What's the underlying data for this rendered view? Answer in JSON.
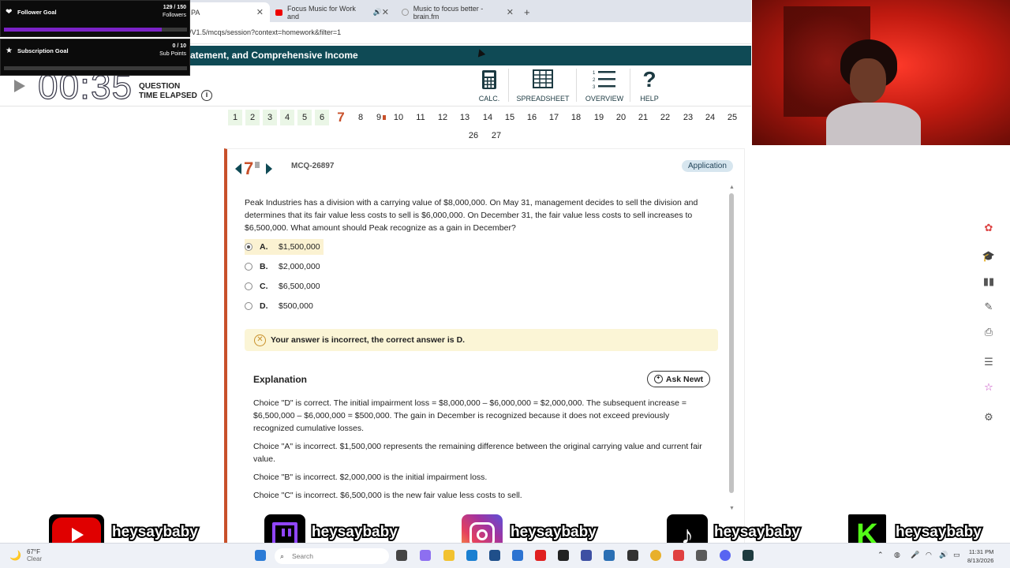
{
  "browser": {
    "tabs": [
      {
        "label": "PA",
        "active": true
      },
      {
        "label": "Focus Music for Work and",
        "active": false
      },
      {
        "label": "Music to focus better - brain.fm",
        "active": false
      }
    ],
    "new_tab": "+",
    "url": "/V1.5/mcqs/session?context=homework&filter=1"
  },
  "app": {
    "header_title": "atement, and Comprehensive Income",
    "timer": "00:35",
    "timer_label_1": "QUESTION",
    "timer_label_2": "TIME ELAPSED",
    "tools": [
      "CALC.",
      "SPREADSHEET",
      "OVERVIEW",
      "HELP"
    ]
  },
  "qnav": {
    "row1": [
      "1",
      "2",
      "3",
      "4",
      "5",
      "6",
      "7",
      "8",
      "9",
      "10",
      "11",
      "12",
      "13",
      "14",
      "15",
      "16",
      "17",
      "18",
      "19",
      "20",
      "21",
      "22",
      "23",
      "24",
      "25"
    ],
    "row2": [
      "26",
      "27"
    ],
    "current": "7"
  },
  "question": {
    "number": "7",
    "id": "MCQ-26897",
    "badge": "Application",
    "stem": "Peak Industries has a division with a carrying value of $8,000,000. On May 31, management decides to sell the division and determines that its fair value less costs to sell is $6,000,000. On December 31, the fair value less costs to sell increases to $6,500,000. What amount should Peak recognize as a gain in December?",
    "choices": [
      {
        "letter": "A.",
        "text": "$1,500,000",
        "selected": true
      },
      {
        "letter": "B.",
        "text": "$2,000,000",
        "selected": false
      },
      {
        "letter": "C.",
        "text": "$6,500,000",
        "selected": false
      },
      {
        "letter": "D.",
        "text": "$500,000",
        "selected": false
      }
    ],
    "feedback": "Your answer is incorrect, the correct answer is D."
  },
  "explanation": {
    "title": "Explanation",
    "ask_button": "Ask Newt",
    "paragraphs": [
      "Choice \"D\" is correct. The initial impairment loss = $8,000,000 – $6,000,000 = $2,000,000. The subsequent increase = $6,500,000 – $6,000,000 = $500,000. The gain in December is recognized because it does not exceed previously recognized cumulative losses.",
      "Choice \"A\" is incorrect. $1,500,000 represents the remaining difference between the original carrying value and current fair value.",
      "Choice \"B\" is incorrect. $2,000,000 is the initial impairment loss.",
      "Choice \"C\" is incorrect. $6,500,000 is the new fair value less costs to sell."
    ]
  },
  "overlay": {
    "follower_goal": {
      "name": "Follower Goal",
      "value": "129 / 150",
      "sub": "Followers",
      "progress": 0.86
    },
    "sub_goal": {
      "name": "Subscription Goal",
      "value": "0 / 10",
      "sub": "Sub Points",
      "progress": 0.0
    },
    "socials": [
      {
        "platform": "youtube",
        "handle": "heysaybaby",
        "color": "#e00000"
      },
      {
        "platform": "twitch",
        "handle": "heysaybaby",
        "color": "#7a3fd0"
      },
      {
        "platform": "instagram",
        "handle": "heysaybaby",
        "color": "#d6249f"
      },
      {
        "platform": "tiktok",
        "handle": "heysaybaby",
        "color": "#000000"
      },
      {
        "platform": "kick",
        "handle": "heysaybaby",
        "color": "#53fc18"
      }
    ]
  },
  "taskbar": {
    "weather_temp": "67°F",
    "weather_desc": "Clear",
    "search_placeholder": "Search",
    "time": "11:31 PM",
    "date": "8/13/2026"
  }
}
